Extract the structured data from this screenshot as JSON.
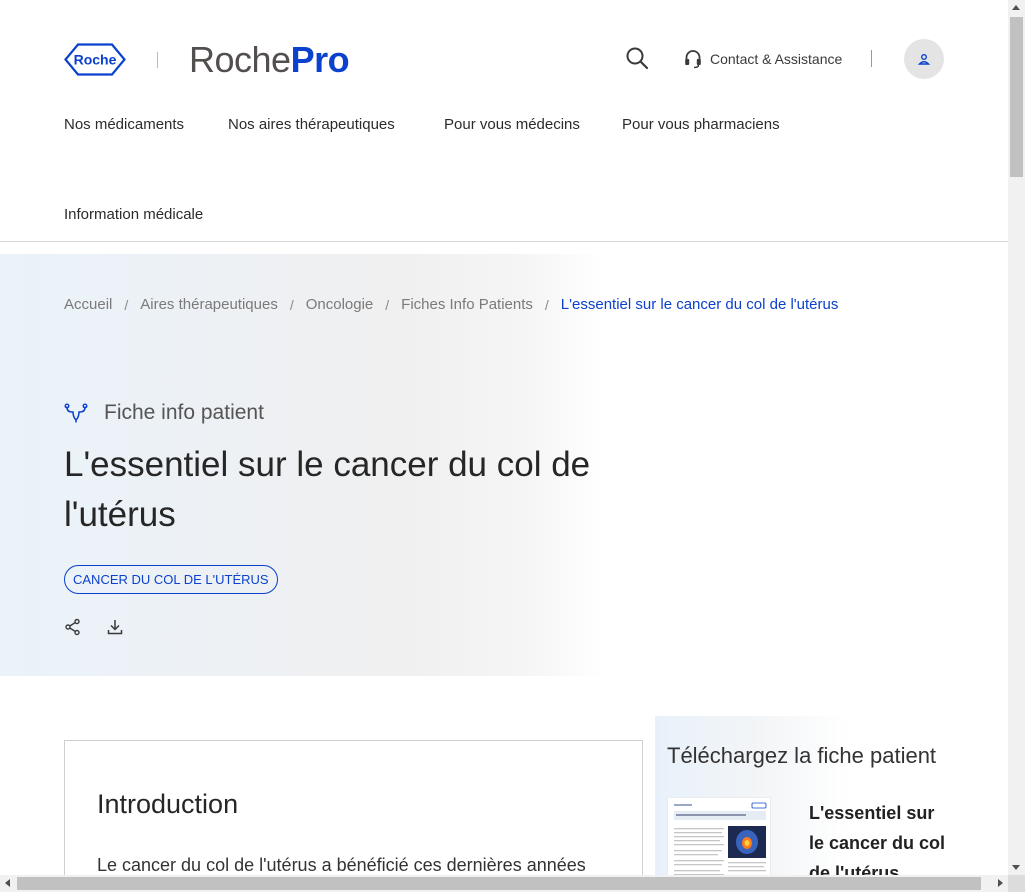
{
  "header": {
    "roche_logo_text": "Roche",
    "brand_part1": "Roche",
    "brand_part2": "Pro",
    "contact_label": "Contact & Assistance"
  },
  "nav": {
    "items": [
      "Nos médicaments",
      "Nos aires thérapeutiques",
      "Pour vous médecins",
      "Pour vous pharmaciens",
      "Information médicale"
    ]
  },
  "breadcrumb": {
    "items": [
      "Accueil",
      "Aires thérapeutiques",
      "Oncologie",
      "Fiches Info Patients"
    ],
    "current": "L'essentiel sur le cancer du col de l'utérus",
    "separator": "/"
  },
  "hero": {
    "kind_label": "Fiche info patient",
    "title": "L'essentiel sur le cancer du col de l'utérus",
    "tag": "CANCER DU COL DE L'UTÉRUS"
  },
  "intro": {
    "title": "Introduction",
    "text": "Le cancer du col de l'utérus a bénéficié ces dernières années"
  },
  "aside": {
    "title": "Téléchargez la fiche patient",
    "doc_title": "L'essentiel sur le cancer du col de l'utérus"
  },
  "colors": {
    "brand_blue": "#0b41cd",
    "brand_grey": "#544f4f"
  },
  "icons": [
    "roche-logo",
    "search-icon",
    "headset-icon",
    "user-icon",
    "uterus-icon",
    "share-icon",
    "download-icon"
  ]
}
